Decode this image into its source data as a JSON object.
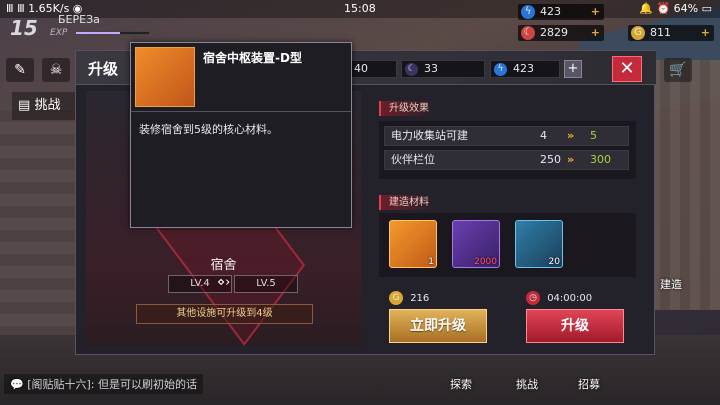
{
  "statusbar": {
    "left": "Ⅲ Ⅲ 1.65K/s ◉",
    "time": "15:08",
    "right": "🔔 ⏰ 64% ▭"
  },
  "player": {
    "level": "15",
    "name": "БЕРЕЗа",
    "exp_label": "EXP",
    "exp_fraction": 0.6
  },
  "resources": [
    {
      "icon": "energy-icon",
      "value": "423",
      "color": "#2a76d8"
    },
    {
      "icon": "moon-icon",
      "value": "2829",
      "color": "#c44"
    },
    {
      "icon": "gold-icon",
      "value": "811",
      "color": "#d9a62e"
    }
  ],
  "dialog": {
    "title": "升级",
    "costs": [
      {
        "icon": "gold-icon",
        "value": "40"
      },
      {
        "icon": "moon-icon",
        "value": "33"
      },
      {
        "icon": "energy-icon",
        "value": "423"
      }
    ],
    "building": {
      "name": "宿舍",
      "lv_from": "LV.4",
      "lv_to": "LV.5"
    },
    "note": "其他设施可升级到4级",
    "effect_tag": "升级效果",
    "effects": [
      {
        "name": "电力收集站可建",
        "old": "4",
        "arrow": "»",
        "new": "5"
      },
      {
        "name": "伙伴栏位",
        "old": "250",
        "arrow": "»",
        "new": "300"
      }
    ],
    "material_tag": "建造材料",
    "materials": [
      {
        "name": "core-device-item",
        "count": "1"
      },
      {
        "name": "tower-item",
        "count": "2000"
      },
      {
        "name": "moon-item",
        "count": "20"
      }
    ],
    "instant_cost": "216",
    "timer": "04:00:00",
    "instant_label": "立即升级",
    "upgrade_label": "升级"
  },
  "tooltip": {
    "title": "宿舍中枢装置-D型",
    "description": "装修宿舍到5级的核心材料。"
  },
  "left_menu": {
    "challenge": "挑战"
  },
  "bottom_menu": [
    {
      "label": "探索"
    },
    {
      "label": "挑战"
    },
    {
      "label": "招募"
    }
  ],
  "side_menu": {
    "build": "建造"
  },
  "chat": "[阁贴贴十六]: 但是可以刷初始的话"
}
